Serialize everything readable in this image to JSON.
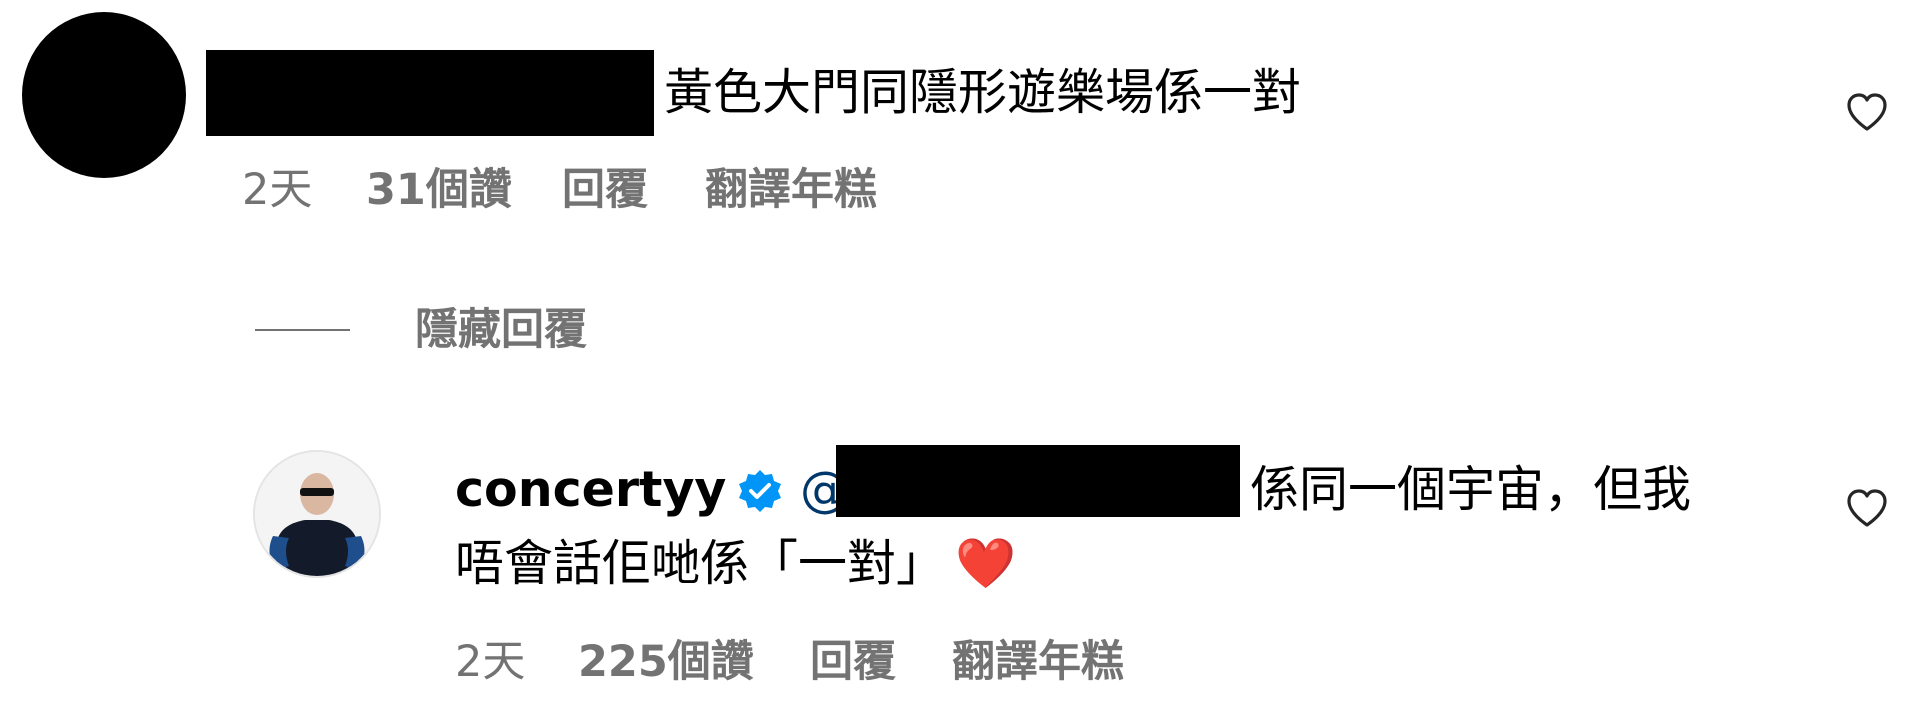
{
  "comment": {
    "text": "黃色大門同隱形遊樂場係一對",
    "time": "2天",
    "likes": "31個讚",
    "reply_label": "回覆",
    "translate_label": "翻譯年糕"
  },
  "hide_replies_label": "隱藏回覆",
  "reply": {
    "username": "concertyy",
    "mention_prefix": "@",
    "text_line1": "係同一個宇宙，但我",
    "text_line2": "唔會話佢哋係「一對」",
    "emoji": "❤️",
    "time": "2天",
    "likes": "225個讚",
    "reply_label": "回覆",
    "translate_label": "翻譯年糕"
  },
  "icons": {
    "heart": "heart-outline-icon",
    "verified": "verified-badge-icon"
  },
  "colors": {
    "meta_text": "#737373",
    "mention": "#00376b",
    "verified": "#0095f6",
    "emoji_heart": "#e0162b"
  }
}
